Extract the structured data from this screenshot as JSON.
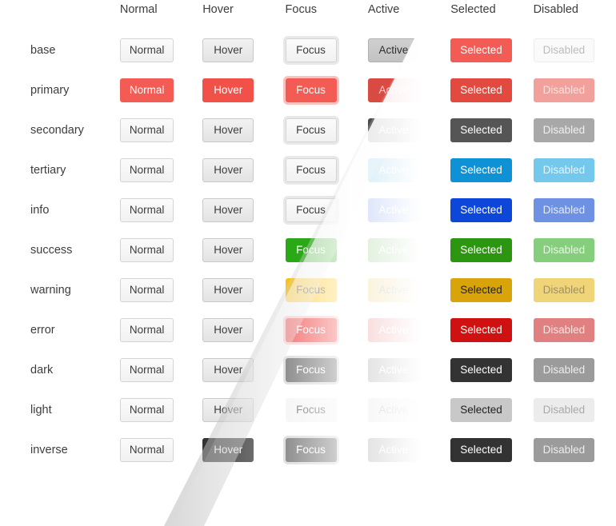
{
  "columns": [
    {
      "key": "normal",
      "label": "Normal"
    },
    {
      "key": "hover",
      "label": "Hover"
    },
    {
      "key": "focus",
      "label": "Focus"
    },
    {
      "key": "active",
      "label": "Active"
    },
    {
      "key": "selected",
      "label": "Selected"
    },
    {
      "key": "disabled",
      "label": "Disabled"
    }
  ],
  "row_label_header": "",
  "rows": [
    {
      "name": "base",
      "cells": [
        {
          "label": "Normal",
          "style": "neutral",
          "bg": "#f5f5f5",
          "fg": "#3d3d3d"
        },
        {
          "label": "Hover",
          "style": "neutral-hover",
          "bg": "#eaeaea",
          "fg": "#3d3d3d"
        },
        {
          "label": "Focus",
          "style": "neutral-focus",
          "bg": "#f5f5f5",
          "fg": "#3d3d3d"
        },
        {
          "label": "Active",
          "style": "neutral-active",
          "bg": "#c8c8c8",
          "fg": "#2e2e2e"
        },
        {
          "label": "Selected",
          "style": "solid",
          "bg": "#f35c54",
          "fg": "#ffffff"
        },
        {
          "label": "Disabled",
          "style": "neutral-disabled",
          "bg": "#fafafa",
          "fg": "#bfbfbf"
        }
      ]
    },
    {
      "name": "primary",
      "cells": [
        {
          "label": "Normal",
          "style": "solid",
          "bg": "#f35c54",
          "fg": "#ffffff"
        },
        {
          "label": "Hover",
          "style": "solid",
          "bg": "#f15148",
          "fg": "#ffffff"
        },
        {
          "label": "Focus",
          "style": "solid-ring",
          "bg": "#f35c54",
          "fg": "#ffffff",
          "ring": "rgba(243,92,84,0.38)"
        },
        {
          "label": "Active",
          "style": "solid",
          "bg": "#d94a42",
          "fg": "#f0cfcd"
        },
        {
          "label": "Selected",
          "style": "solid",
          "bg": "#e2493f",
          "fg": "#ffffff"
        },
        {
          "label": "Disabled",
          "style": "disabled",
          "bg": "#f2a09b",
          "fg": "#fbe2e0"
        }
      ]
    },
    {
      "name": "secondary",
      "cells": [
        {
          "label": "Normal",
          "style": "neutral",
          "bg": "#f5f5f5",
          "fg": "#3d3d3d"
        },
        {
          "label": "Hover",
          "style": "neutral-hover",
          "bg": "#eaeaea",
          "fg": "#3d3d3d"
        },
        {
          "label": "Focus",
          "style": "neutral-focus",
          "bg": "#f5f5f5",
          "fg": "#3d3d3d"
        },
        {
          "label": "Active",
          "style": "solid",
          "bg": "#4a4a4a",
          "fg": "#ffffff"
        },
        {
          "label": "Selected",
          "style": "solid",
          "bg": "#555555",
          "fg": "#ffffff"
        },
        {
          "label": "Disabled",
          "style": "disabled",
          "bg": "#a8a8a8",
          "fg": "#efefef"
        }
      ]
    },
    {
      "name": "tertiary",
      "cells": [
        {
          "label": "Normal",
          "style": "neutral",
          "bg": "#f5f5f5",
          "fg": "#3d3d3d"
        },
        {
          "label": "Hover",
          "style": "neutral-hover",
          "bg": "#eaeaea",
          "fg": "#3d3d3d"
        },
        {
          "label": "Focus",
          "style": "neutral-focus",
          "bg": "#f5f5f5",
          "fg": "#3d3d3d"
        },
        {
          "label": "Active",
          "style": "solid",
          "bg": "#0e92d5",
          "fg": "#ffffff"
        },
        {
          "label": "Selected",
          "style": "solid",
          "bg": "#0e92d5",
          "fg": "#ffffff"
        },
        {
          "label": "Disabled",
          "style": "disabled",
          "bg": "#74c8ec",
          "fg": "#e6f5fd"
        }
      ]
    },
    {
      "name": "info",
      "cells": [
        {
          "label": "Normal",
          "style": "neutral",
          "bg": "#f5f5f5",
          "fg": "#3d3d3d"
        },
        {
          "label": "Hover",
          "style": "neutral-hover",
          "bg": "#eaeaea",
          "fg": "#3d3d3d"
        },
        {
          "label": "Focus",
          "style": "neutral-focus",
          "bg": "#f5f5f5",
          "fg": "#3d3d3d"
        },
        {
          "label": "Active",
          "style": "solid",
          "bg": "#0d47d9",
          "fg": "#ffffff"
        },
        {
          "label": "Selected",
          "style": "solid",
          "bg": "#0d47d9",
          "fg": "#ffffff"
        },
        {
          "label": "Disabled",
          "style": "disabled",
          "bg": "#6f91e4",
          "fg": "#e4ebfb"
        }
      ]
    },
    {
      "name": "success",
      "cells": [
        {
          "label": "Normal",
          "style": "neutral",
          "bg": "#f5f5f5",
          "fg": "#3d3d3d"
        },
        {
          "label": "Hover",
          "style": "neutral-hover",
          "bg": "#eaeaea",
          "fg": "#3d3d3d"
        },
        {
          "label": "Focus",
          "style": "solid",
          "bg": "#2ba818",
          "fg": "#ffffff"
        },
        {
          "label": "Active",
          "style": "solid",
          "bg": "#2d9611",
          "fg": "#ffffff"
        },
        {
          "label": "Selected",
          "style": "solid",
          "bg": "#2d9611",
          "fg": "#ffffff"
        },
        {
          "label": "Disabled",
          "style": "disabled",
          "bg": "#85ce7b",
          "fg": "#eaf7e7"
        }
      ]
    },
    {
      "name": "warning",
      "cells": [
        {
          "label": "Normal",
          "style": "neutral",
          "bg": "#f5f5f5",
          "fg": "#3d3d3d"
        },
        {
          "label": "Hover",
          "style": "neutral-hover",
          "bg": "#eaeaea",
          "fg": "#3d3d3d"
        },
        {
          "label": "Focus",
          "style": "solid",
          "bg": "#ffc20e",
          "fg": "#1f1f1f"
        },
        {
          "label": "Active",
          "style": "solid",
          "bg": "#d9a40a",
          "fg": "#1f1f1f"
        },
        {
          "label": "Selected",
          "style": "solid",
          "bg": "#d9a40a",
          "fg": "#1f1f1f"
        },
        {
          "label": "Disabled",
          "style": "disabled",
          "bg": "#f0d578",
          "fg": "#a09064"
        }
      ]
    },
    {
      "name": "error",
      "cells": [
        {
          "label": "Normal",
          "style": "neutral",
          "bg": "#f5f5f5",
          "fg": "#3d3d3d"
        },
        {
          "label": "Hover",
          "style": "neutral-hover",
          "bg": "#eaeaea",
          "fg": "#3d3d3d"
        },
        {
          "label": "Focus",
          "style": "solid-ring",
          "bg": "#ec1313",
          "fg": "#ffffff",
          "ring": "rgba(236,19,19,0.30)"
        },
        {
          "label": "Active",
          "style": "solid",
          "bg": "#cf1111",
          "fg": "#ffffff"
        },
        {
          "label": "Selected",
          "style": "solid",
          "bg": "#cf1111",
          "fg": "#ffffff"
        },
        {
          "label": "Disabled",
          "style": "disabled",
          "bg": "#e08080",
          "fg": "#f8e6e6"
        }
      ]
    },
    {
      "name": "dark",
      "cells": [
        {
          "label": "Normal",
          "style": "neutral",
          "bg": "#f5f5f5",
          "fg": "#3d3d3d"
        },
        {
          "label": "Hover",
          "style": "neutral-hover",
          "bg": "#eaeaea",
          "fg": "#3d3d3d"
        },
        {
          "label": "Focus",
          "style": "solid-ring",
          "bg": "#333333",
          "fg": "#ffffff",
          "ring": "rgba(120,120,120,0.40)"
        },
        {
          "label": "Active",
          "style": "solid",
          "bg": "#333333",
          "fg": "#ffffff"
        },
        {
          "label": "Selected",
          "style": "solid",
          "bg": "#333333",
          "fg": "#ffffff"
        },
        {
          "label": "Disabled",
          "style": "disabled",
          "bg": "#9b9b9b",
          "fg": "#ededed"
        }
      ]
    },
    {
      "name": "light",
      "cells": [
        {
          "label": "Normal",
          "style": "neutral",
          "bg": "#f5f5f5",
          "fg": "#3d3d3d"
        },
        {
          "label": "Hover",
          "style": "neutral-hover",
          "bg": "#eaeaea",
          "fg": "#3d3d3d"
        },
        {
          "label": "Focus",
          "style": "solid",
          "bg": "#f0f0f0",
          "fg": "#1f1f1f"
        },
        {
          "label": "Active",
          "style": "solid",
          "bg": "#c8c8c8",
          "fg": "#1f1f1f"
        },
        {
          "label": "Selected",
          "style": "solid",
          "bg": "#c8c8c8",
          "fg": "#1f1f1f"
        },
        {
          "label": "Disabled",
          "style": "disabled",
          "bg": "#ececec",
          "fg": "#a9a9a9"
        }
      ]
    },
    {
      "name": "inverse",
      "cells": [
        {
          "label": "Normal",
          "style": "neutral",
          "bg": "#f5f5f5",
          "fg": "#3d3d3d"
        },
        {
          "label": "Hover",
          "style": "solid",
          "bg": "#333333",
          "fg": "#ffffff"
        },
        {
          "label": "Focus",
          "style": "solid-ring",
          "bg": "#333333",
          "fg": "#ffffff",
          "ring": "rgba(120,120,120,0.40)"
        },
        {
          "label": "Active",
          "style": "solid",
          "bg": "#333333",
          "fg": "#ffffff"
        },
        {
          "label": "Selected",
          "style": "solid",
          "bg": "#333333",
          "fg": "#ffffff"
        },
        {
          "label": "Disabled",
          "style": "disabled",
          "bg": "#9b9b9b",
          "fg": "#ededed"
        }
      ]
    }
  ],
  "palette": {
    "background": "#ffffff",
    "text": "#3d3d3d",
    "primary": "#f35c54",
    "secondary": "#4a4a4a",
    "tertiary": "#0e92d5",
    "info": "#0d47d9",
    "success": "#2d9611",
    "warning": "#ffc20e",
    "error": "#ec1313",
    "dark": "#333333",
    "light": "#c8c8c8"
  }
}
